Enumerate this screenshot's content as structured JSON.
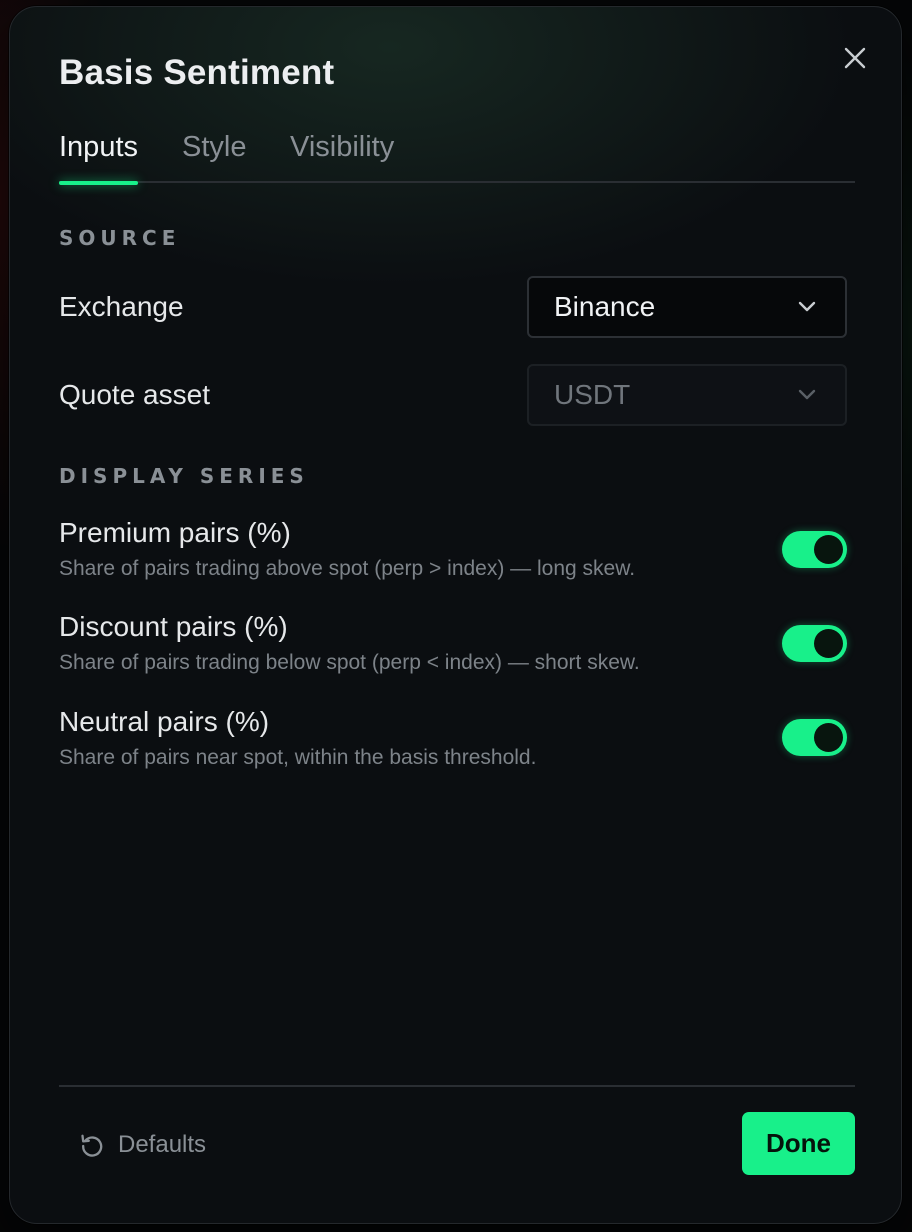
{
  "dialog": {
    "title": "Basis Sentiment"
  },
  "tabs": [
    {
      "label": "Inputs",
      "active": true
    },
    {
      "label": "Style",
      "active": false
    },
    {
      "label": "Visibility",
      "active": false
    }
  ],
  "source": {
    "heading": "SOURCE",
    "exchange": {
      "label": "Exchange",
      "value": "Binance",
      "disabled": false
    },
    "quote_asset": {
      "label": "Quote asset",
      "value": "USDT",
      "disabled": true
    }
  },
  "display_series": {
    "heading": "DISPLAY SERIES",
    "items": [
      {
        "title": "Premium pairs (%)",
        "description": "Share of pairs trading above spot (perp > index) — long skew.",
        "enabled": true
      },
      {
        "title": "Discount pairs (%)",
        "description": "Share of pairs trading below spot (perp < index) — short skew.",
        "enabled": true
      },
      {
        "title": "Neutral pairs (%)",
        "description": "Share of pairs near spot, within the basis threshold.",
        "enabled": true
      }
    ]
  },
  "footer": {
    "defaults_label": "Defaults",
    "done_label": "Done"
  },
  "colors": {
    "accent": "#18f08a",
    "background": "#0b0e11"
  },
  "icons": {
    "close": "close-icon",
    "chevron": "chevron-down-icon",
    "reset": "reset-icon"
  }
}
